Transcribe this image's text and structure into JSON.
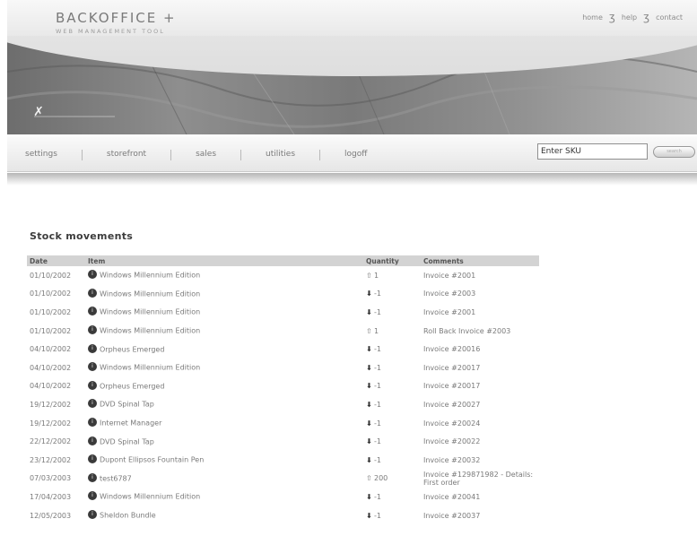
{
  "header": {
    "brand_name": "BACKOFFICE +",
    "brand_tagline": "WEB MANAGEMENT TOOL",
    "links": [
      "home",
      "help",
      "contact"
    ]
  },
  "nav": {
    "items": [
      "settings",
      "storefront",
      "sales",
      "utilities",
      "logoff"
    ],
    "sku_value": "Enter SKU",
    "search_button": "search"
  },
  "page": {
    "title": "Stock movements"
  },
  "table": {
    "columns": [
      "Date",
      "Item",
      "Quantity",
      "Comments"
    ],
    "rows": [
      {
        "date": "01/10/2002",
        "item": "Windows Millennium Edition",
        "dir": "up",
        "qty": "1",
        "comment": "Invoice #2001"
      },
      {
        "date": "01/10/2002",
        "item": "Windows Millennium Edition",
        "dir": "down",
        "qty": "-1",
        "comment": "Invoice #2003"
      },
      {
        "date": "01/10/2002",
        "item": "Windows Millennium Edition",
        "dir": "down",
        "qty": "-1",
        "comment": "Invoice #2001"
      },
      {
        "date": "01/10/2002",
        "item": "Windows Millennium Edition",
        "dir": "up",
        "qty": "1",
        "comment": "Roll Back Invoice #2003"
      },
      {
        "date": "04/10/2002",
        "item": "Orpheus Emerged",
        "dir": "down",
        "qty": "-1",
        "comment": "Invoice #20016"
      },
      {
        "date": "04/10/2002",
        "item": "Windows Millennium Edition",
        "dir": "down",
        "qty": "-1",
        "comment": "Invoice #20017"
      },
      {
        "date": "04/10/2002",
        "item": "Orpheus Emerged",
        "dir": "down",
        "qty": "-1",
        "comment": "Invoice #20017"
      },
      {
        "date": "19/12/2002",
        "item": "DVD Spinal Tap",
        "dir": "down",
        "qty": "-1",
        "comment": "Invoice #20027"
      },
      {
        "date": "19/12/2002",
        "item": "Internet Manager",
        "dir": "down",
        "qty": "-1",
        "comment": "Invoice #20024"
      },
      {
        "date": "22/12/2002",
        "item": "DVD Spinal Tap",
        "dir": "down",
        "qty": "-1",
        "comment": "Invoice #20022"
      },
      {
        "date": "23/12/2002",
        "item": "Dupont Ellipsos Fountain Pen",
        "dir": "down",
        "qty": "-1",
        "comment": "Invoice #20032"
      },
      {
        "date": "07/03/2003",
        "item": "test6787",
        "dir": "up",
        "qty": "200",
        "comment": "Invoice #129871982 - Details: First order"
      },
      {
        "date": "17/04/2003",
        "item": "Windows Millennium Edition",
        "dir": "down",
        "qty": "-1",
        "comment": "Invoice #20041"
      },
      {
        "date": "12/05/2003",
        "item": "Sheldon Bundle",
        "dir": "down",
        "qty": "-1",
        "comment": "Invoice #20037"
      }
    ]
  },
  "icons": {
    "up": "arrow-up-icon",
    "down": "arrow-down-icon",
    "item": "info-circle-icon"
  },
  "colors": {
    "header_row": "#d3d3d3",
    "banner": "#7a7a7a",
    "text": "#7a7a7a"
  }
}
